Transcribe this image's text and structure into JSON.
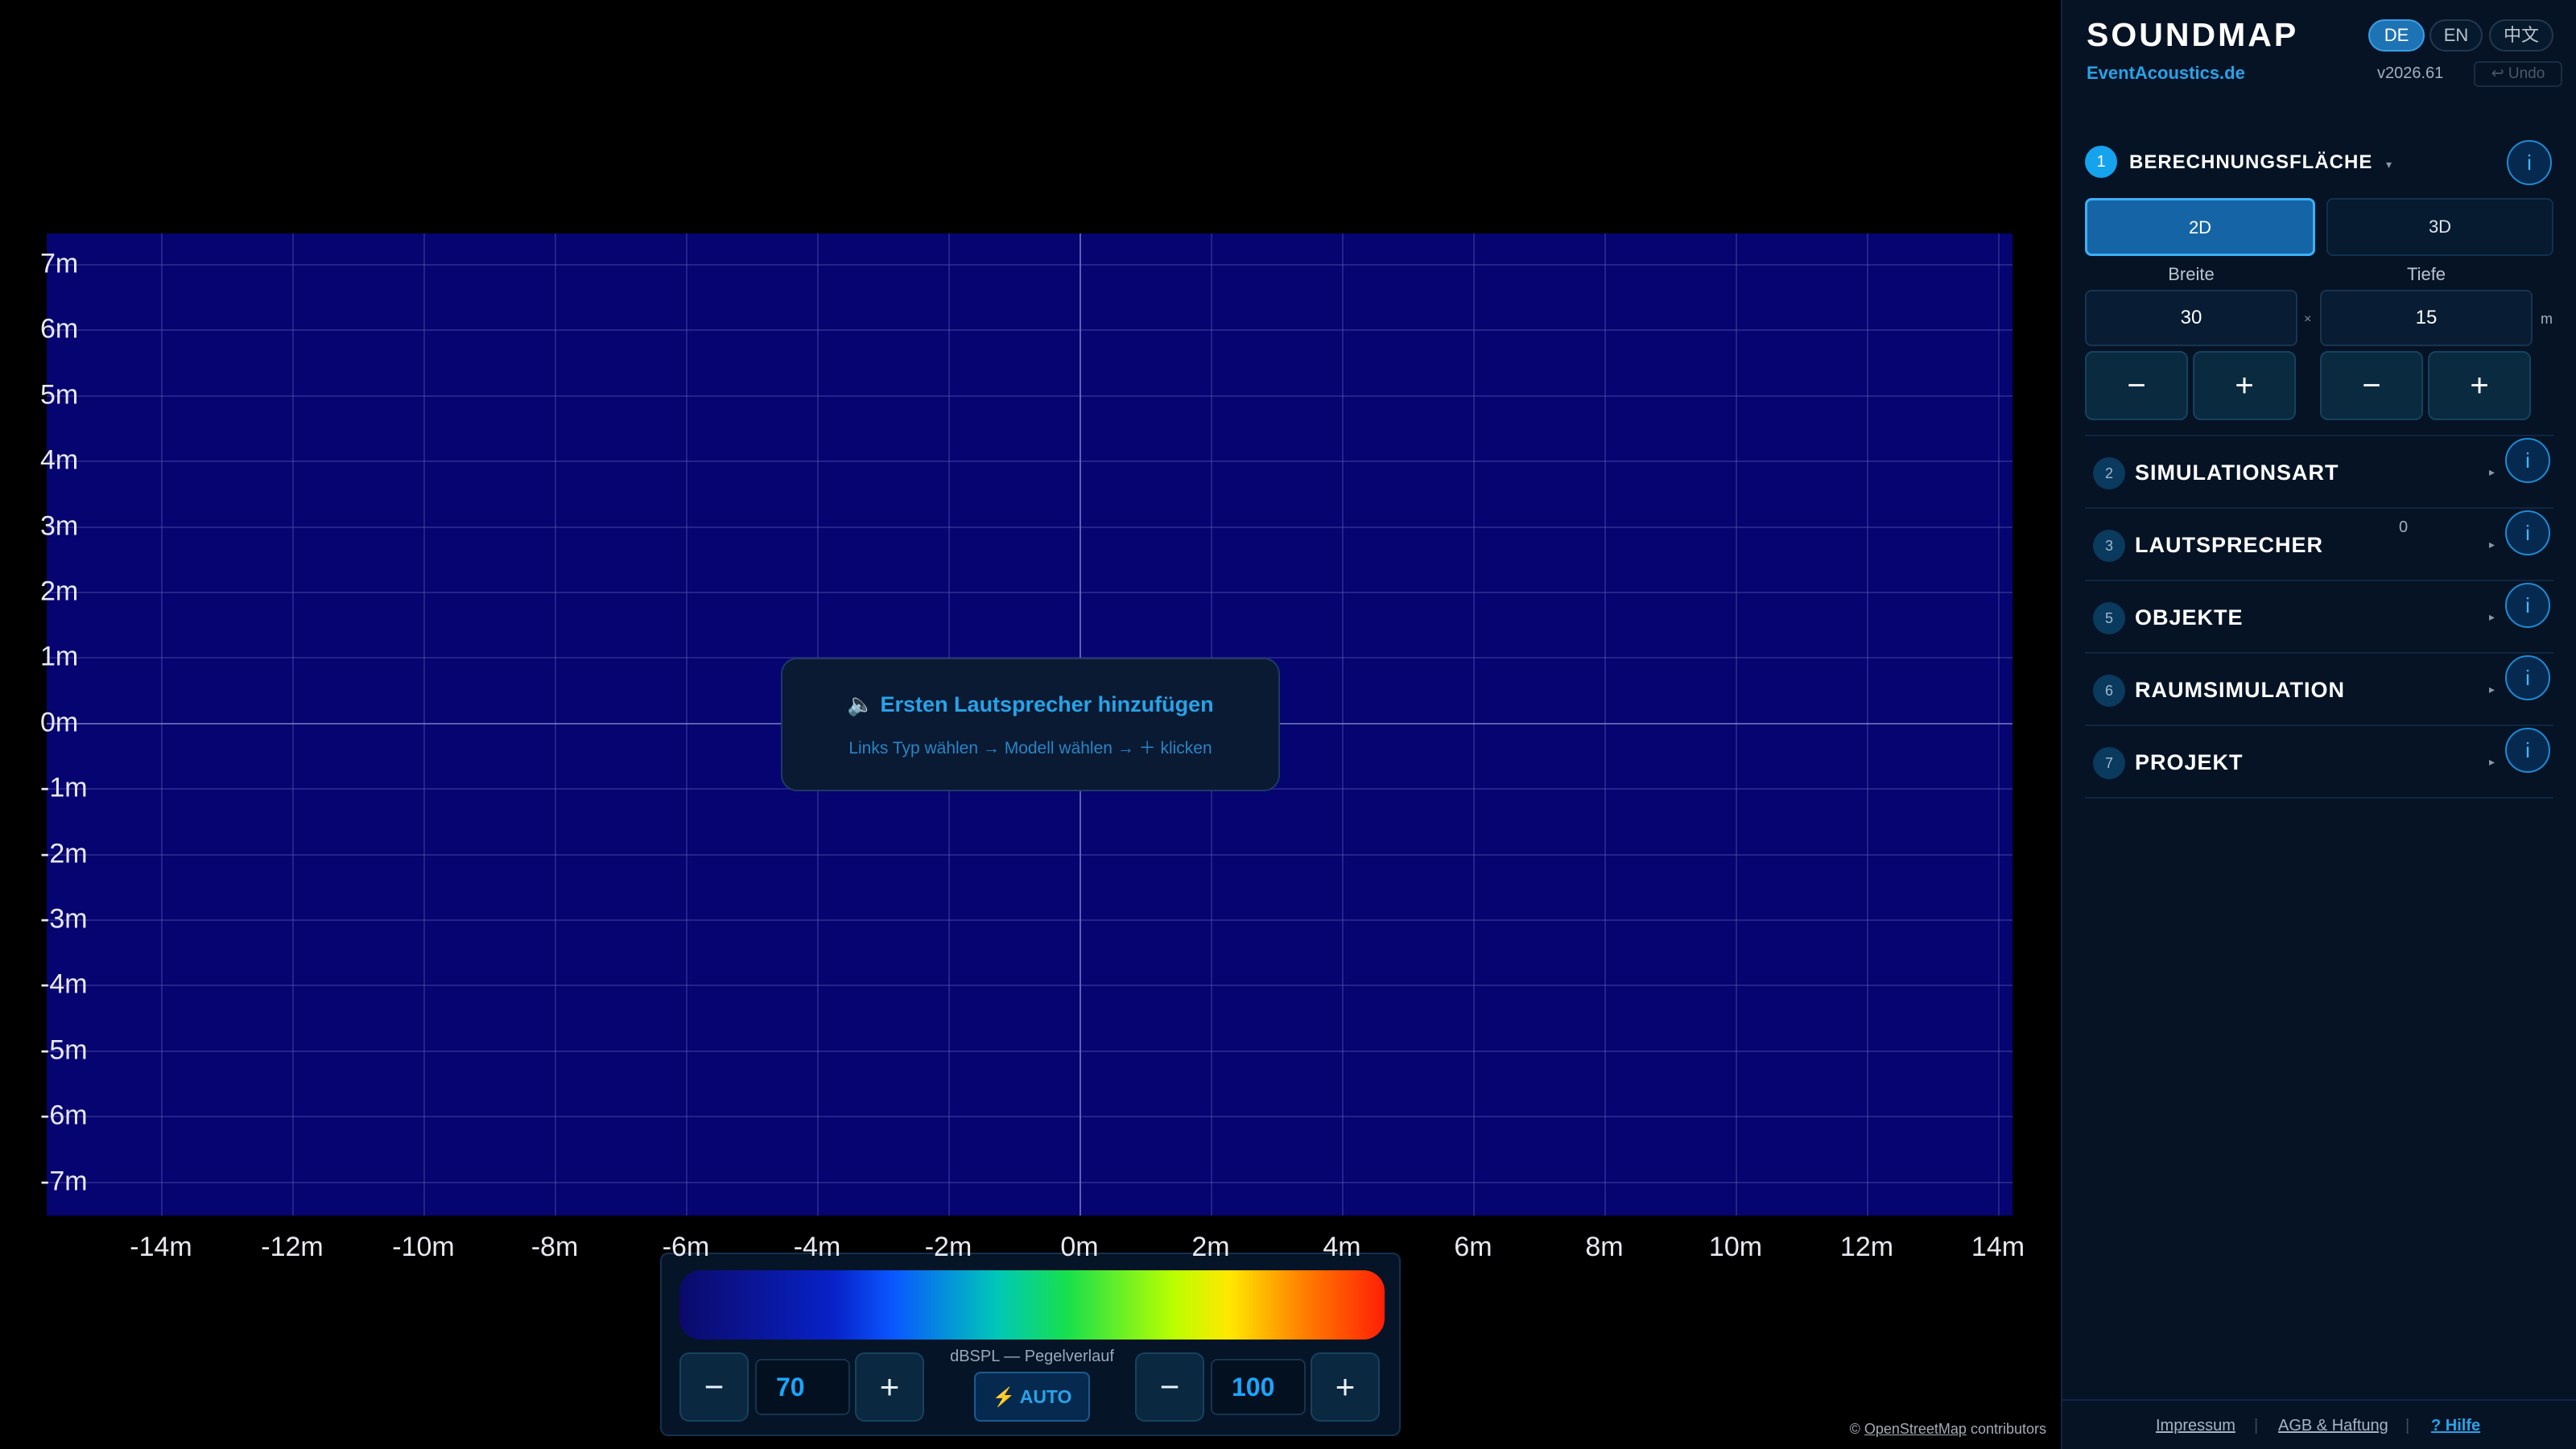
{
  "map": {
    "y_ticks": [
      "7m",
      "6m",
      "5m",
      "4m",
      "3m",
      "2m",
      "1m",
      "0m",
      "-1m",
      "-2m",
      "-3m",
      "-4m",
      "-5m",
      "-6m",
      "-7m"
    ],
    "x_ticks": [
      "-14m",
      "-12m",
      "-10m",
      "-8m",
      "-6m",
      "-4m",
      "-2m",
      "0m",
      "2m",
      "4m",
      "6m",
      "8m",
      "10m",
      "12m",
      "14m"
    ],
    "hint": {
      "title": "🔈 Ersten Lautsprecher hinzufügen",
      "subtitle": "Links Typ wählen → Modell wählen → ＋ klicken"
    },
    "attribution": {
      "prefix": "© ",
      "link": "OpenStreetMap",
      "suffix": " contributors"
    }
  },
  "legend": {
    "label": "dBSPL — Pegelverlauf",
    "min_value": "70",
    "max_value": "100",
    "auto_label": "⚡ AUTO",
    "minus": "−",
    "plus": "+"
  },
  "sidebar": {
    "logo": "SOUNDMAP",
    "brand": "EventAcoustics.de",
    "version": "v2026.61",
    "undo": "↩ Undo",
    "languages": [
      "DE",
      "EN",
      "中文"
    ],
    "active_language": "DE",
    "section1": {
      "number": "1",
      "title": "BERECHNUNGSFLÄCHE",
      "modes": [
        "2D",
        "3D"
      ],
      "active_mode": "2D",
      "width_label": "Breite",
      "depth_label": "Tiefe",
      "width_value": "30",
      "depth_value": "15",
      "times": "×",
      "unit": "m",
      "minus": "−",
      "plus": "+"
    },
    "sections": [
      {
        "number": "2",
        "title": "SIMULATIONSART",
        "count": ""
      },
      {
        "number": "3",
        "title": "LAUTSPRECHER",
        "count": "0"
      },
      {
        "number": "5",
        "title": "OBJEKTE",
        "count": ""
      },
      {
        "number": "6",
        "title": "RAUMSIMULATION",
        "count": ""
      },
      {
        "number": "7",
        "title": "PROJEKT",
        "count": ""
      }
    ],
    "info": "i",
    "chevron_open": "▾",
    "chevron_closed": "▸",
    "footer": {
      "impressum": "Impressum",
      "agb": "AGB & Haftung",
      "hilfe": "? Hilfe",
      "separator": "|"
    }
  },
  "colors": {
    "accent": "#27a3e8",
    "plot_background": "#050470",
    "sidebar_background": "#051325"
  }
}
